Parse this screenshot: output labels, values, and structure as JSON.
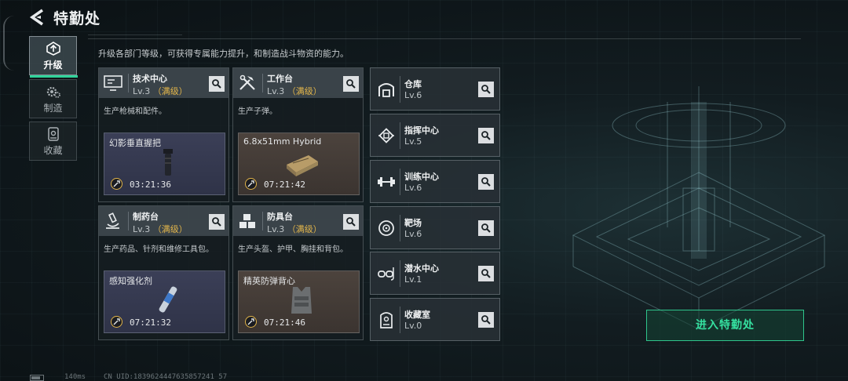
{
  "header": {
    "title": "特勤处"
  },
  "tabs": [
    {
      "label": "升级",
      "icon": "upgrade-icon",
      "active": true
    },
    {
      "label": "制造",
      "icon": "gear-icon",
      "active": false
    },
    {
      "label": "收藏",
      "icon": "collection-icon",
      "active": false
    }
  ],
  "description": "升级各部门等级，可获得专属能力提升，和制造战斗物资的能力。",
  "departments": [
    {
      "name": "技术中心",
      "level": "Lv.3",
      "max_label": "（满级）",
      "icon": "monitor-icon",
      "desc": "生产枪械和配件。",
      "product": "幻影垂直握把",
      "timer": "03:21:36",
      "theme": "blue"
    },
    {
      "name": "工作台",
      "level": "Lv.3",
      "max_label": "（满级）",
      "icon": "tools-icon",
      "desc": "生产子弹。",
      "product": "6.8x51mm Hybrid",
      "timer": "07:21:42",
      "theme": "brown"
    },
    {
      "name": "制药台",
      "level": "Lv.3",
      "max_label": "（满级）",
      "icon": "microscope-icon",
      "desc": "生产药品、针剂和维修工具包。",
      "product": "感知强化剂",
      "timer": "07:21:32",
      "theme": "blue"
    },
    {
      "name": "防具台",
      "level": "Lv.3",
      "max_label": "（满级）",
      "icon": "armor-blocks-icon",
      "desc": "生产头盔、护甲、胸挂和背包。",
      "product": "精英防弹背心",
      "timer": "07:21:46",
      "theme": "brown"
    }
  ],
  "facilities": [
    {
      "name": "仓库",
      "level": "Lv.6",
      "icon": "warehouse-icon"
    },
    {
      "name": "指挥中心",
      "level": "Lv.5",
      "icon": "chip-icon"
    },
    {
      "name": "训练中心",
      "level": "Lv.6",
      "icon": "dumbbell-icon"
    },
    {
      "name": "靶场",
      "level": "Lv.6",
      "icon": "target-icon"
    },
    {
      "name": "潜水中心",
      "level": "Lv.1",
      "icon": "diving-mask-icon"
    },
    {
      "name": "收藏室",
      "level": "Lv.0",
      "icon": "trophy-case-icon"
    }
  ],
  "enter_button": "进入特勤处",
  "footer": {
    "ping": "140ms",
    "uid": "CN UID:1839624447635857241 57"
  },
  "colors": {
    "accent_green": "#2fd39a",
    "max_level": "#e2b54a"
  }
}
